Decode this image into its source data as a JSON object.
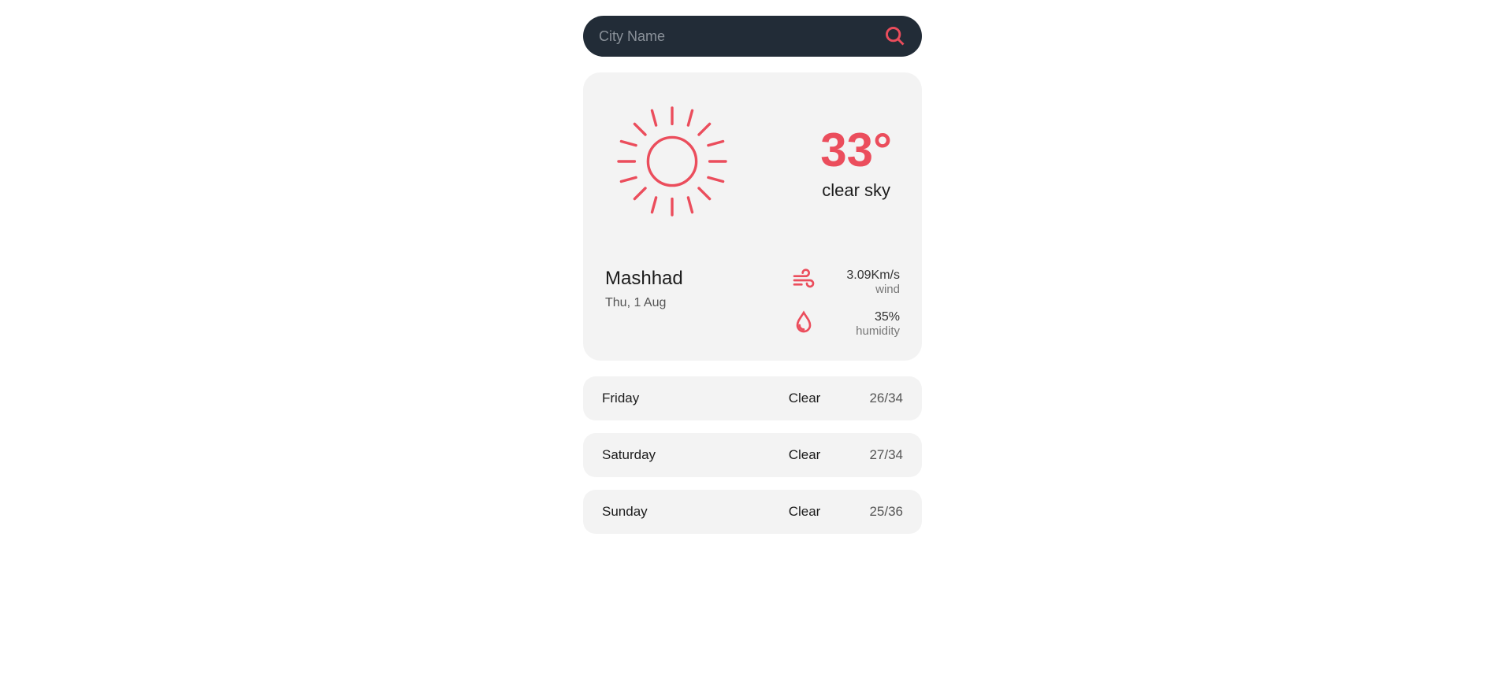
{
  "colors": {
    "accent": "#eb4d5c",
    "searchbar_bg": "#222c37",
    "card_bg": "#f3f3f3"
  },
  "search": {
    "placeholder": "City Name",
    "value": ""
  },
  "current": {
    "temp": "33°",
    "condition": "clear sky",
    "city": "Mashhad",
    "date": "Thu, 1 Aug",
    "wind_value": "3.09Km/s",
    "wind_label": "wind",
    "humidity_value": "35%",
    "humidity_label": "humidity"
  },
  "forecast": [
    {
      "day": "Friday",
      "condition": "Clear",
      "temps": "26/34"
    },
    {
      "day": "Saturday",
      "condition": "Clear",
      "temps": "27/34"
    },
    {
      "day": "Sunday",
      "condition": "Clear",
      "temps": "25/36"
    }
  ]
}
